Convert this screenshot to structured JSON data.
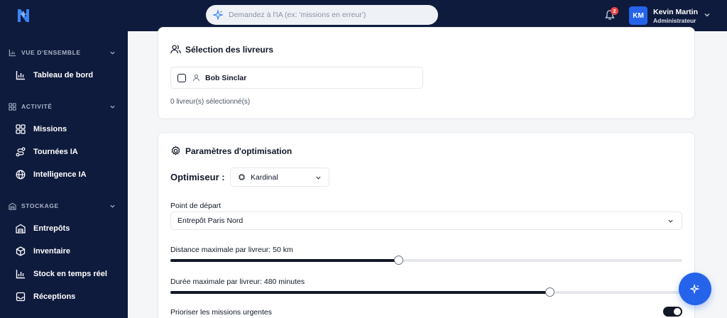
{
  "header": {
    "search_placeholder": "Demandez à l'IA (ex: 'missions en erreur')",
    "notifications_count": "2",
    "user": {
      "initials": "KM",
      "name": "Kevin Martin",
      "role": "Administrateur"
    }
  },
  "sidebar": {
    "sections": [
      {
        "label": "VUE D'ENSEMBLE",
        "icon": "chart-icon",
        "items": [
          {
            "label": "Tableau de bord",
            "icon": "bar-chart-icon"
          }
        ]
      },
      {
        "label": "ACTIVITÉ",
        "icon": "grid-icon",
        "items": [
          {
            "label": "Missions",
            "icon": "grid-icon"
          },
          {
            "label": "Tournées IA",
            "icon": "route-icon"
          },
          {
            "label": "Intelligence IA",
            "icon": "globe-icon"
          }
        ]
      },
      {
        "label": "STOCKAGE",
        "icon": "warehouse-icon",
        "items": [
          {
            "label": "Entrepôts",
            "icon": "warehouse-icon"
          },
          {
            "label": "Inventaire",
            "icon": "package-icon"
          },
          {
            "label": "Stock en temps réel",
            "icon": "bar-chart-icon"
          },
          {
            "label": "Réceptions",
            "icon": "inbox-icon"
          }
        ]
      }
    ]
  },
  "drivers_card": {
    "title": "Sélection des livreurs",
    "drivers": [
      {
        "name": "Bob Sinclar",
        "checked": false
      }
    ],
    "selected_text": "0 livreur(s) sélectionné(s)"
  },
  "optimization_card": {
    "title": "Paramètres d'optimisation",
    "optimizer_label": "Optimiseur :",
    "optimizer_value": "Kardinal",
    "start_label": "Point de départ",
    "start_value": "Entrepôt Paris Nord",
    "max_distance_label": "Distance maximale par livreur: 50 km",
    "max_distance_fraction": 0.445,
    "max_duration_label": "Durée maximale par livreur: 480 minutes",
    "max_duration_fraction": 0.74,
    "urgent_label": "Prioriser les missions urgentes",
    "urgent_enabled": true
  },
  "colors": {
    "navy": "#0f1b3d",
    "accent": "#2563eb",
    "badge": "#ef4444"
  }
}
